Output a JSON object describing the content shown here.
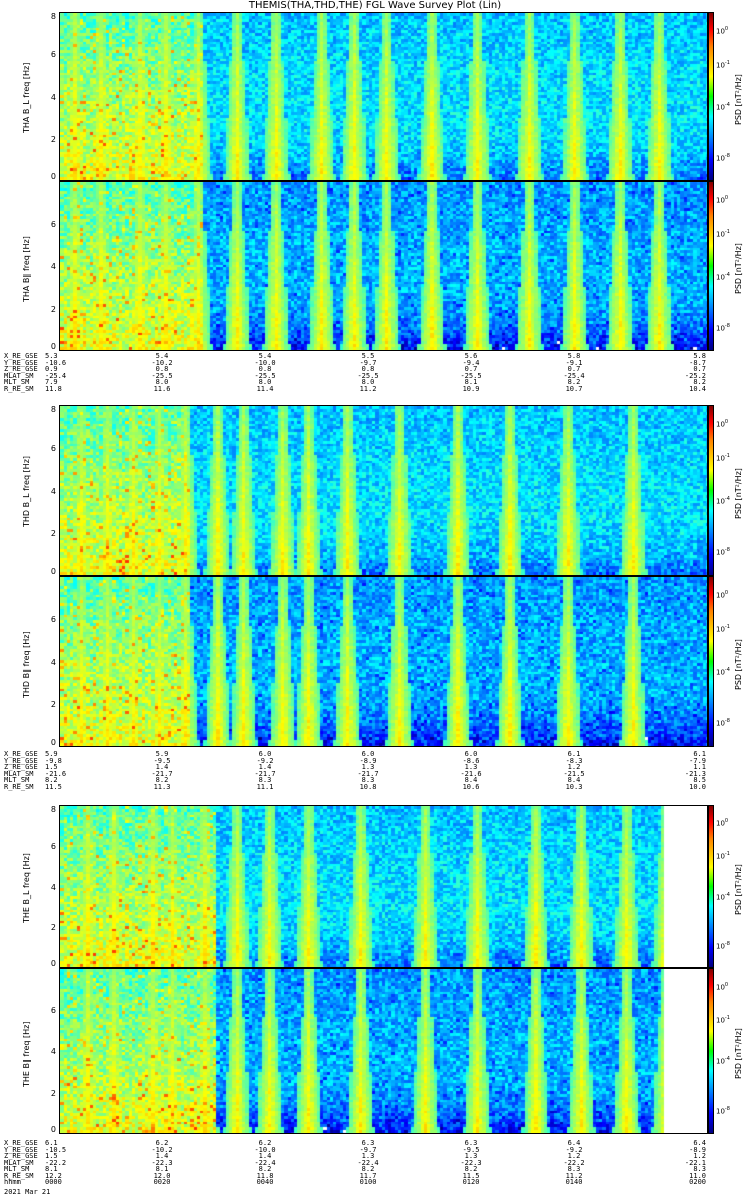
{
  "title": "THEMIS(THA,THD,THE) FGL Wave Survey Plot (Lin)",
  "date_label": "2021 Mar 21",
  "colors": {
    "frame": "#000000",
    "background": "#ffffff"
  },
  "chart_data": [
    {
      "type": "heatmap",
      "probe": "THA",
      "panels": [
        {
          "component": "B_L",
          "ylabel_line1": "THA B_L",
          "ylabel_line2": "freq [Hz]",
          "yticks": [
            "0",
            "2",
            "4",
            "6",
            "8"
          ],
          "ylim": [
            0,
            8
          ],
          "colorbar_ticks": [
            "10-8",
            "10-4",
            "10-1",
            "100"
          ],
          "colorbar_label": "PSD [nT²/Hz]",
          "bursts": [
            2,
            6,
            12,
            16,
            21,
            27,
            33,
            40,
            45,
            50,
            57,
            64,
            72,
            79,
            86,
            92
          ],
          "dense_end": 22
        },
        {
          "component": "B_parallel",
          "ylabel_line1": "THA B‖",
          "ylabel_line2": "freq [Hz]",
          "yticks": [
            "0",
            "2",
            "4",
            "6"
          ],
          "ylim": [
            0,
            8
          ],
          "colorbar_ticks": [
            "10-8",
            "10-4",
            "10-1",
            "100"
          ],
          "colorbar_label": "PSD [nT²/Hz]",
          "bursts": [
            2,
            6,
            12,
            16,
            21,
            27,
            33,
            40,
            45,
            50,
            57,
            64,
            72,
            79,
            86,
            92
          ],
          "dense_end": 22
        }
      ],
      "orbit_rows": [
        "X_RE_GSE",
        "Y_RE_GSE",
        "Z_RE_GSE",
        "MLAT_SM",
        "MLT_SM",
        "R_RE_SM"
      ],
      "orbit_values": [
        [
          "5.3",
          "5.4",
          "5.4",
          "5.5",
          "5.6",
          "5.8",
          "5.8"
        ],
        [
          "-10.6",
          "-10.2",
          "-10.0",
          "-9.7",
          "-9.4",
          "-9.1",
          "-8.7"
        ],
        [
          "0.9",
          "0.8",
          "0.8",
          "0.8",
          "0.7",
          "0.7",
          "0.7"
        ],
        [
          "-25.4",
          "-25.5",
          "-25.5",
          "-25.5",
          "-25.5",
          "-25.4",
          "-25.2"
        ],
        [
          "7.9",
          "8.0",
          "8.0",
          "8.0",
          "8.1",
          "8.2",
          "8.2"
        ],
        [
          "11.8",
          "11.6",
          "11.4",
          "11.2",
          "10.9",
          "10.7",
          "10.4"
        ]
      ]
    },
    {
      "type": "heatmap",
      "probe": "THD",
      "panels": [
        {
          "component": "B_L",
          "ylabel_line1": "THD B_L",
          "ylabel_line2": "freq [Hz]",
          "yticks": [
            "0",
            "2",
            "4",
            "6",
            "8"
          ],
          "ylim": [
            0,
            8
          ],
          "colorbar_ticks": [
            "10-8",
            "10-4",
            "10-1",
            "100"
          ],
          "colorbar_label": "PSD [nT²/Hz]",
          "bursts": [
            3,
            7,
            11,
            15,
            19,
            24,
            28,
            34,
            38,
            44,
            52,
            61,
            69,
            78,
            88
          ],
          "dense_end": 20
        },
        {
          "component": "B_parallel",
          "ylabel_line1": "THD B‖",
          "ylabel_line2": "freq [Hz]",
          "yticks": [
            "0",
            "2",
            "4",
            "6"
          ],
          "ylim": [
            0,
            8
          ],
          "colorbar_ticks": [
            "10-8",
            "10-4",
            "10-1",
            "100"
          ],
          "colorbar_label": "PSD [nT²/Hz]",
          "bursts": [
            3,
            7,
            11,
            15,
            19,
            24,
            28,
            34,
            38,
            44,
            52,
            61,
            69,
            78,
            88
          ],
          "dense_end": 20
        }
      ],
      "orbit_rows": [
        "X_RE_GSE",
        "Y_RE_GSE",
        "Z_RE_GSE",
        "MLAT_SM",
        "MLT_SM",
        "R_RE_SM"
      ],
      "orbit_values": [
        [
          "5.9",
          "5.9",
          "6.0",
          "6.0",
          "6.0",
          "6.1",
          "6.1"
        ],
        [
          "-9.8",
          "-9.5",
          "-9.2",
          "-8.9",
          "-8.6",
          "-8.3",
          "-7.9"
        ],
        [
          "1.5",
          "1.4",
          "1.4",
          "1.3",
          "1.3",
          "1.2",
          "1.1"
        ],
        [
          "-21.6",
          "-21.7",
          "-21.7",
          "-21.7",
          "-21.6",
          "-21.5",
          "-21.3"
        ],
        [
          "8.2",
          "8.2",
          "8.3",
          "8.3",
          "8.4",
          "8.4",
          "8.5"
        ],
        [
          "11.5",
          "11.3",
          "11.1",
          "10.8",
          "10.6",
          "10.3",
          "10.0"
        ]
      ]
    },
    {
      "type": "heatmap",
      "probe": "THE",
      "panels": [
        {
          "component": "B_L",
          "ylabel_line1": "THE B_L",
          "ylabel_line2": "freq [Hz]",
          "yticks": [
            "0",
            "2",
            "4",
            "6",
            "8"
          ],
          "ylim": [
            0,
            8
          ],
          "colorbar_ticks": [
            "10-8",
            "10-4",
            "10-1",
            "100"
          ],
          "colorbar_label": "PSD [nT²/Hz]",
          "bursts": [
            4,
            8,
            14,
            17,
            22,
            27,
            32,
            38,
            46,
            56,
            64,
            73,
            80,
            87,
            93
          ],
          "dense_end": 24,
          "data_end": 0.93
        },
        {
          "component": "B_parallel",
          "ylabel_line1": "THE B‖",
          "ylabel_line2": "freq [Hz]",
          "yticks": [
            "0",
            "2",
            "4",
            "6"
          ],
          "ylim": [
            0,
            8
          ],
          "colorbar_ticks": [
            "10-8",
            "10-4",
            "10-1",
            "100"
          ],
          "colorbar_label": "PSD [nT²/Hz]",
          "bursts": [
            4,
            8,
            14,
            17,
            22,
            27,
            32,
            38,
            46,
            56,
            64,
            73,
            80,
            87,
            93
          ],
          "dense_end": 24,
          "data_end": 0.93
        }
      ],
      "orbit_rows": [
        "X_RE_GSE",
        "Y_RE_GSE",
        "Z_RE_GSE",
        "MLAT_SM",
        "MLT_SM",
        "R_RE_SM",
        "hhmm"
      ],
      "orbit_values": [
        [
          "6.1",
          "6.2",
          "6.2",
          "6.3",
          "6.3",
          "6.4",
          "6.4"
        ],
        [
          "-10.5",
          "-10.2",
          "-10.0",
          "-9.7",
          "-9.5",
          "-9.2",
          "-8.9"
        ],
        [
          "1.5",
          "1.4",
          "1.4",
          "1.3",
          "1.3",
          "1.2",
          "1.2"
        ],
        [
          "-22.2",
          "-22.3",
          "-22.4",
          "-22.4",
          "-22.3",
          "-22.2",
          "-22.1"
        ],
        [
          "8.1",
          "8.1",
          "8.2",
          "8.2",
          "8.2",
          "8.3",
          "8.3"
        ],
        [
          "12.2",
          "12.0",
          "11.8",
          "11.7",
          "11.5",
          "11.2",
          "11.0"
        ],
        [
          "0000",
          "0020",
          "0040",
          "0100",
          "0120",
          "0140",
          "0200"
        ]
      ]
    }
  ]
}
